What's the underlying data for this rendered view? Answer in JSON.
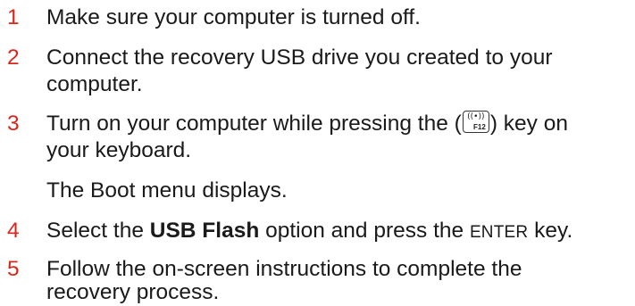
{
  "steps": [
    {
      "number": "1",
      "lines": [
        "Make sure your computer is turned off."
      ]
    },
    {
      "number": "2",
      "lines": [
        "Connect the recovery USB drive you created to your",
        "computer."
      ]
    },
    {
      "number": "3",
      "line1_before": "Turn on your computer while pressing the (",
      "line1_after": ") key on",
      "line2": "your keyboard.",
      "key": {
        "icon": "wireless-icon",
        "label": "F12"
      },
      "note": "The Boot menu displays."
    },
    {
      "number": "4",
      "before": "Select the ",
      "bold": "USB Flash",
      "middle": " option and press the ",
      "caps": "ENTER",
      "after": " key."
    },
    {
      "number": "5",
      "lines": [
        "Follow the on-screen instructions to complete the",
        "recovery process."
      ]
    }
  ],
  "colors": {
    "step_number": "#d7281c",
    "text": "#1a1a1a"
  }
}
